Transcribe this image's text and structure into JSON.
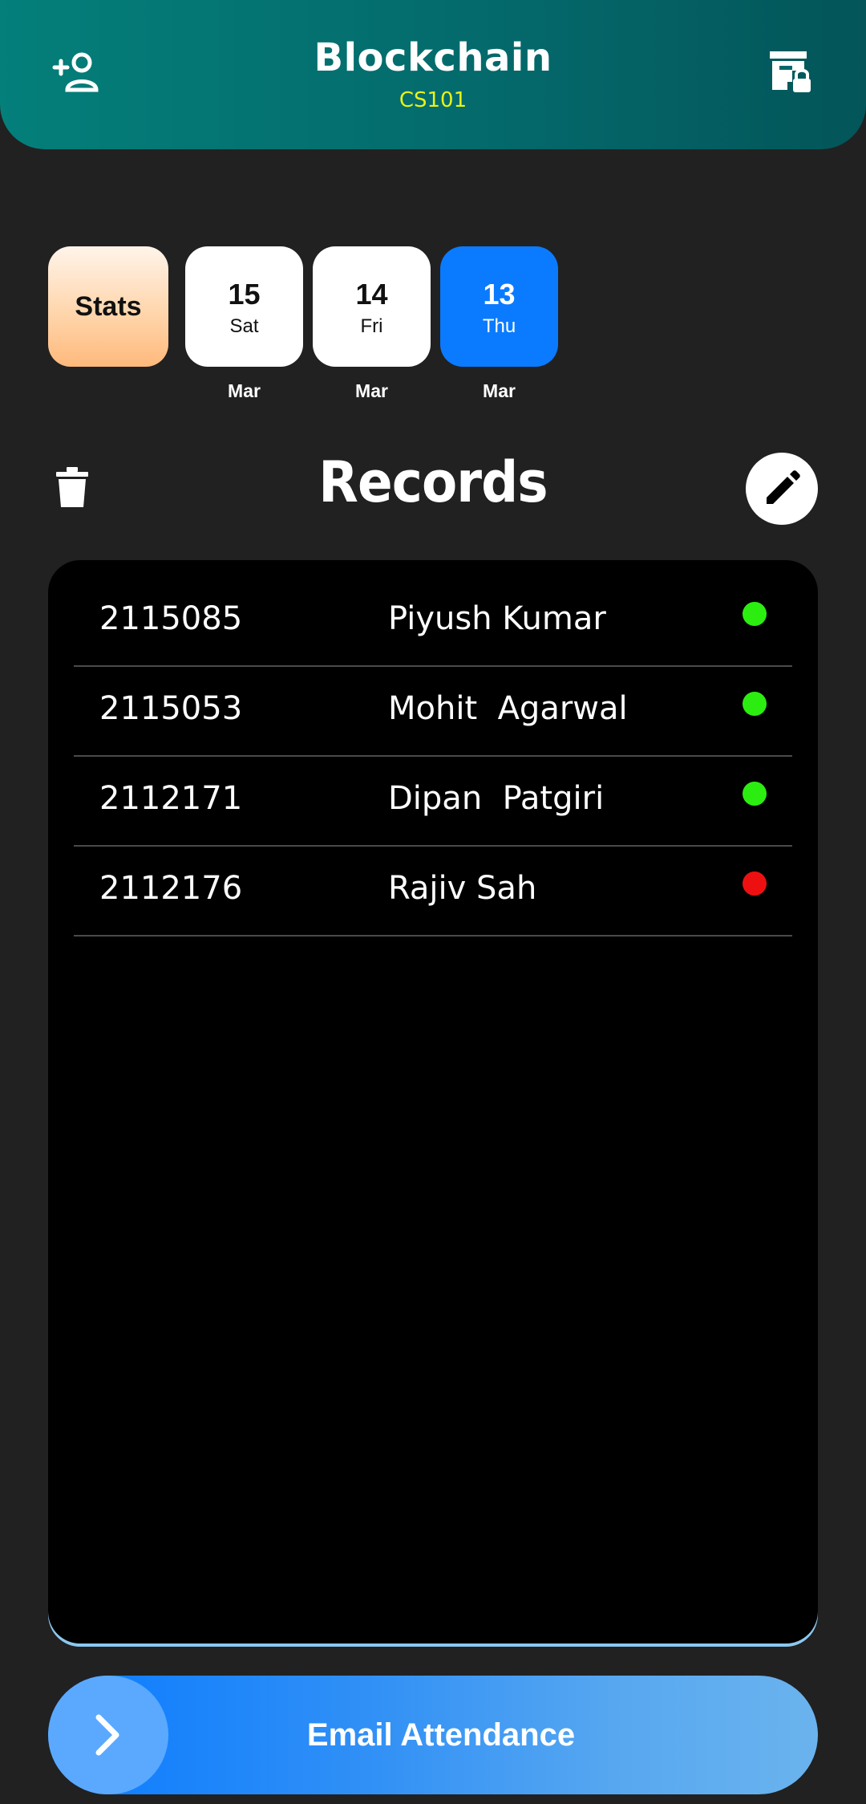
{
  "header": {
    "title": "Blockchain",
    "course_code": "CS101",
    "add_user_icon": "person-add-icon",
    "lock_icon": "archive-lock-icon"
  },
  "date_selector": {
    "stats_label": "Stats",
    "dates": [
      {
        "num": "15",
        "day": "Sat",
        "month": "Mar",
        "selected": false
      },
      {
        "num": "14",
        "day": "Fri",
        "month": "Mar",
        "selected": false
      },
      {
        "num": "13",
        "day": "Thu",
        "month": "Mar",
        "selected": true
      }
    ]
  },
  "records": {
    "title": "Records",
    "delete_icon": "trash-icon",
    "edit_icon": "pencil-icon",
    "rows": [
      {
        "id": "2115085",
        "name": "Piyush Kumar",
        "status": "present"
      },
      {
        "id": "2115053",
        "name": "Mohit  Agarwal",
        "status": "present"
      },
      {
        "id": "2112171",
        "name": "Dipan  Patgiri",
        "status": "present"
      },
      {
        "id": "2112176",
        "name": "Rajiv Sah",
        "status": "absent"
      }
    ]
  },
  "colors": {
    "present": "#2bee10",
    "absent": "#ee1010",
    "accent": "#0a7bff",
    "header_teal": "#047f7a",
    "course_code": "#e8f21a"
  },
  "email_button": {
    "label": "Email Attendance",
    "icon": "chevron-right-icon"
  }
}
